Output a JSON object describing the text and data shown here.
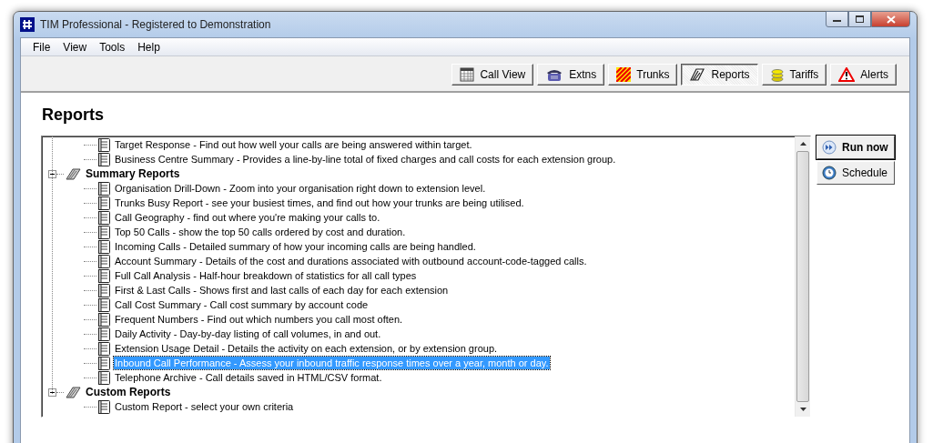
{
  "window": {
    "title": "TIM Professional - Registered to Demonstration"
  },
  "menu": [
    "File",
    "View",
    "Tools",
    "Help"
  ],
  "toolbar": [
    {
      "label": "Call View",
      "selected": false
    },
    {
      "label": "Extns",
      "selected": false
    },
    {
      "label": "Trunks",
      "selected": false
    },
    {
      "label": "Reports",
      "selected": true
    },
    {
      "label": "Tariffs",
      "selected": false
    },
    {
      "label": "Alerts",
      "selected": false
    }
  ],
  "heading": "Reports",
  "tree": [
    {
      "kind": "report",
      "label": "Target Response - Find out how well your calls are being answered within target.",
      "selected": false
    },
    {
      "kind": "report",
      "label": "Business Centre Summary - Provides a line-by-line total of fixed charges and call costs for each extension group.",
      "selected": false
    },
    {
      "kind": "group",
      "label": "Summary Reports",
      "expanded": true,
      "children": [
        {
          "kind": "report",
          "label": "Organisation Drill-Down - Zoom into your organisation right down to extension level.",
          "selected": false
        },
        {
          "kind": "report",
          "label": "Trunks Busy Report - see your busiest times, and find out how your trunks are being utilised.",
          "selected": false
        },
        {
          "kind": "report",
          "label": "Call Geography - find out where you're making your calls to.",
          "selected": false
        },
        {
          "kind": "report",
          "label": "Top 50 Calls - show the top 50 calls ordered by cost and duration.",
          "selected": false
        },
        {
          "kind": "report",
          "label": "Incoming Calls - Detailed summary of how your incoming calls are being handled.",
          "selected": false
        },
        {
          "kind": "report",
          "label": "Account Summary - Details of the cost and durations associated with outbound account-code-tagged calls.",
          "selected": false
        },
        {
          "kind": "report",
          "label": "Full Call Analysis - Half-hour breakdown of statistics for all call types",
          "selected": false
        },
        {
          "kind": "report",
          "label": "First & Last Calls - Shows first and last calls of each day for each extension",
          "selected": false
        },
        {
          "kind": "report",
          "label": "Call Cost Summary - Call cost summary by account code",
          "selected": false
        },
        {
          "kind": "report",
          "label": "Frequent Numbers - Find out which numbers you call most often.",
          "selected": false
        },
        {
          "kind": "report",
          "label": "Daily Activity - Day-by-day listing of call volumes, in and out.",
          "selected": false
        },
        {
          "kind": "report",
          "label": "Extension Usage Detail - Details the activity on each extension, or by extension group.",
          "selected": false
        },
        {
          "kind": "report",
          "label": "Inbound Call Performance - Assess your inbound traffic response times over a year, month or day.",
          "selected": true
        },
        {
          "kind": "report",
          "label": "Telephone Archive - Call details saved in HTML/CSV format.",
          "selected": false
        }
      ]
    },
    {
      "kind": "group",
      "label": "Custom Reports",
      "expanded": true,
      "children": [
        {
          "kind": "report",
          "label": "Custom Report - select your own criteria",
          "selected": false
        }
      ]
    }
  ],
  "actions": [
    {
      "label": "Run now",
      "default": true
    },
    {
      "label": "Schedule",
      "default": false
    }
  ]
}
